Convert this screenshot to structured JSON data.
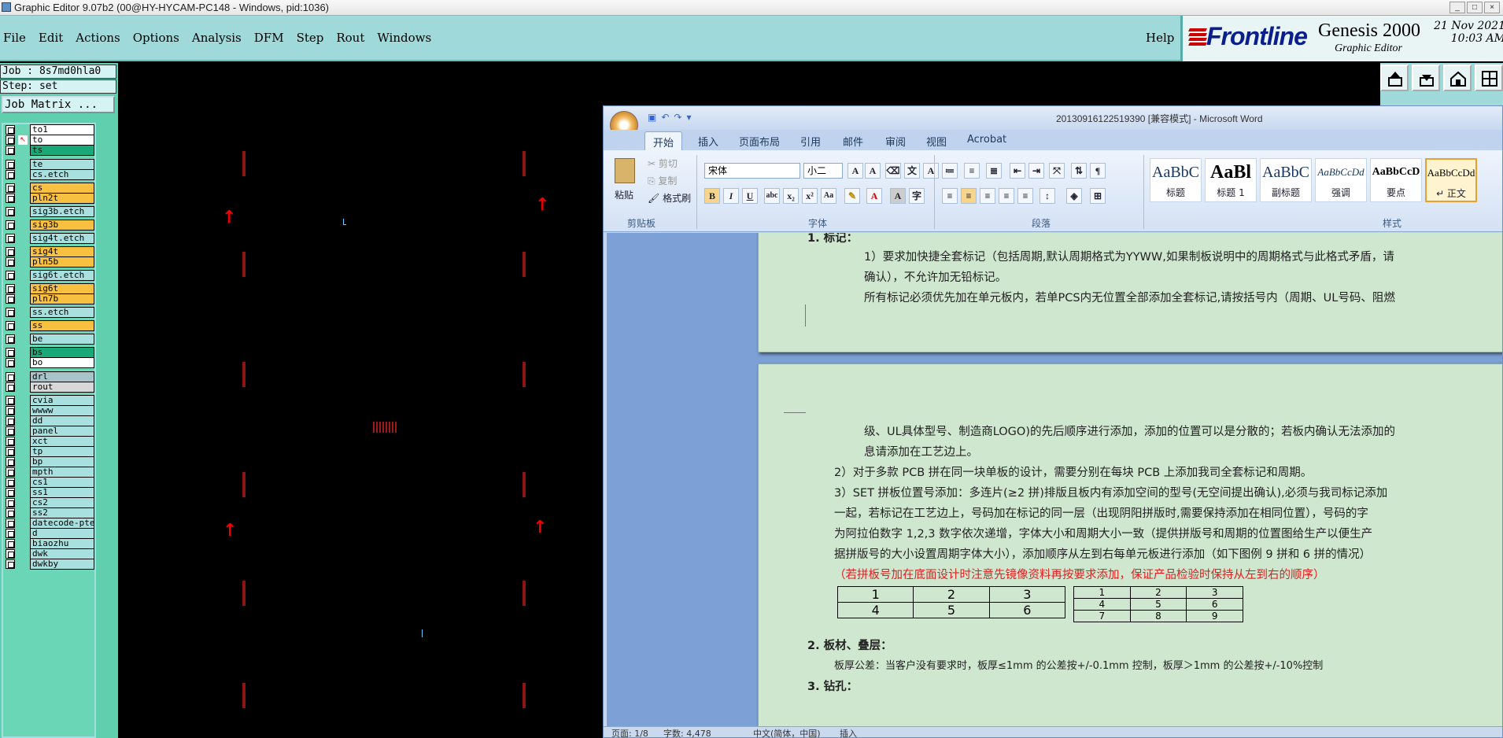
{
  "genesis": {
    "title": "Graphic Editor 9.07b2 (00@HY-HYCAM-PC148 - Windows, pid:1036)",
    "window_controls": [
      "_",
      "□",
      "×"
    ],
    "menu": [
      "File",
      "Edit",
      "Actions",
      "Options",
      "Analysis",
      "DFM",
      "Step",
      "Rout",
      "Windows"
    ],
    "help": "Help",
    "brand": {
      "logo": "Frontline",
      "product": "Genesis 2000",
      "subtitle": "Graphic Editor",
      "date": "21 Nov 2021",
      "time": "10:03 AM"
    },
    "job": "Job : 8s7md0hla0",
    "step": "Step: set",
    "job_matrix": "Job Matrix ...",
    "layers": [
      {
        "name": "to1",
        "color": "#ffffff"
      },
      {
        "name": "to",
        "color": "#ffffff",
        "active": true
      },
      {
        "name": "ts",
        "color": "#1aa878"
      },
      {
        "name": "te",
        "color": "#a8e0e0"
      },
      {
        "name": "cs.etch",
        "color": "#a8e0e0"
      },
      {
        "name": "cs",
        "color": "#f8c040"
      },
      {
        "name": "pln2t",
        "color": "#f8c040"
      },
      {
        "name": "sig3b.etch",
        "color": "#a8e0e0"
      },
      {
        "name": "sig3b",
        "color": "#f8c040"
      },
      {
        "name": "sig4t.etch",
        "color": "#a8e0e0"
      },
      {
        "name": "sig4t",
        "color": "#f8c040"
      },
      {
        "name": "pln5b",
        "color": "#f8c040"
      },
      {
        "name": "sig6t.etch",
        "color": "#a8e0e0"
      },
      {
        "name": "sig6t",
        "color": "#f8c040"
      },
      {
        "name": "pln7b",
        "color": "#f8c040"
      },
      {
        "name": "ss.etch",
        "color": "#a8e0e0"
      },
      {
        "name": "ss",
        "color": "#f8c040"
      },
      {
        "name": "be",
        "color": "#a8e0e0"
      },
      {
        "name": "bs",
        "color": "#1aa878"
      },
      {
        "name": "bo",
        "color": "#ffffff"
      },
      {
        "name": "drl",
        "color": "#a8c4c8"
      },
      {
        "name": "rout",
        "color": "#d8d8d8"
      },
      {
        "name": "cvia",
        "color": "#a8e0e0"
      },
      {
        "name": "wwww",
        "color": "#a8e0e0"
      },
      {
        "name": "dd",
        "color": "#a8e0e0"
      },
      {
        "name": "panel",
        "color": "#a8e0e0"
      },
      {
        "name": "xct",
        "color": "#a8e0e0"
      },
      {
        "name": "tp",
        "color": "#a8e0e0"
      },
      {
        "name": "bp",
        "color": "#a8e0e0"
      },
      {
        "name": "mpth",
        "color": "#a8e0e0"
      },
      {
        "name": "cs1",
        "color": "#a8e0e0"
      },
      {
        "name": "ss1",
        "color": "#a8e0e0"
      },
      {
        "name": "cs2",
        "color": "#a8e0e0"
      },
      {
        "name": "ss2",
        "color": "#a8e0e0"
      },
      {
        "name": "datecode-pte",
        "color": "#a8e0e0"
      },
      {
        "name": "d",
        "color": "#a8e0e0"
      },
      {
        "name": "biaozhu",
        "color": "#a8e0e0"
      },
      {
        "name": "dwk",
        "color": "#a8e0e0"
      },
      {
        "name": "dwkby",
        "color": "#a8e0e0"
      }
    ],
    "canvas_bg": "#000000",
    "toolbar_icons": [
      "upload-icon",
      "download-icon",
      "home-icon",
      "grid-icon"
    ]
  },
  "word": {
    "title": "20130916122519390 [兼容模式] - Microsoft Word",
    "tabs": [
      "开始",
      "插入",
      "页面布局",
      "引用",
      "邮件",
      "审阅",
      "视图",
      "Acrobat"
    ],
    "clipboard": {
      "paste": "粘贴",
      "cut": "剪切",
      "copy": "复制",
      "format_painter": "格式刷",
      "label": "剪贴板"
    },
    "font": {
      "name": "宋体",
      "size": "小二",
      "label": "字体"
    },
    "paragraph_label": "段落",
    "styles": [
      {
        "sample": "AaBbC",
        "name": "标题"
      },
      {
        "sample": "AaBl",
        "name": "标题 1"
      },
      {
        "sample": "AaBbC",
        "name": "副标题"
      },
      {
        "sample": "AaBbCcDd",
        "name": "强调"
      },
      {
        "sample": "AaBbCcD",
        "name": "要点"
      },
      {
        "sample": "AaBbCcDd",
        "name": "↵ 正文"
      }
    ],
    "styles_label": "样式",
    "page1": {
      "heading": "1.   标记：",
      "lines": [
        "1）要求加快捷全套标记（包括周期,默认周期格式为YYWW,如果制板说明中的周期格式与此格式矛盾，请",
        "确认），不允许加无铅标记。",
        "所有标记必须优先加在单元板内，若单PCS内无位置全部添加全套标记,请按括号内（周期、UL号码、阻燃"
      ]
    },
    "page2": {
      "lines": [
        "级、UL具体型号、制造商LOGO)的先后顺序进行添加，添加的位置可以是分散的；若板内确认无法添加的",
        "息请添加在工艺边上。",
        "2）对于多款 PCB 拼在同一块单板的设计，需要分别在每块 PCB 上添加我司全套标记和周期。",
        "3）SET 拼板位置号添加：多连片(≥2 拼)排版且板内有添加空间的型号(无空间提出确认),必须与我司标记添加",
        "一起，若标记在工艺边上，号码加在标记的同一层（出现阴阳拼版时,需要保持添加在相同位置），号码的字",
        "为阿拉伯数字 1,2,3 数字依次递增，字体大小和周期大小一致（提供拼版号和周期的位置图给生产以便生产",
        "据拼版号的大小设置周期字体大小），添加顺序从左到右每单元板进行添加（如下图例 9 拼和 6 拼的情况）"
      ],
      "red": "（若拼板号加在底面设计时注意先镜像资料再按要求添加，保证产品检验时保持从左到右的顺序）",
      "table6": [
        [
          "1",
          "2",
          "3"
        ],
        [
          "4",
          "5",
          "6"
        ]
      ],
      "table9": [
        [
          "1",
          "2",
          "3"
        ],
        [
          "4",
          "5",
          "6"
        ],
        [
          "7",
          "8",
          "9"
        ]
      ],
      "heading2": "2.   板材、叠层：",
      "line2": "板厚公差：当客户没有要求时，板厚≤1mm 的公差按+/-0.1mm 控制，板厚＞1mm 的公差按+/-10%控制",
      "heading3": "3.   钻孔："
    },
    "status": {
      "page": "页面: 1/8",
      "words": "字数: 4,478",
      "lang": "中文(简体，中国)",
      "mode": "插入"
    }
  }
}
